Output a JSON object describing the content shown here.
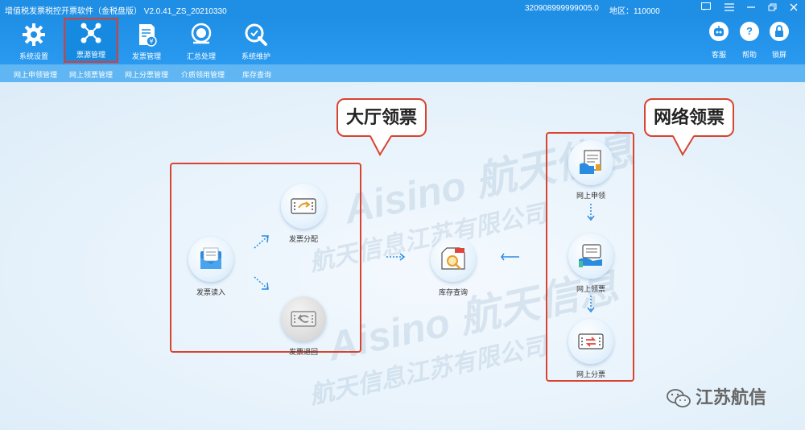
{
  "titlebar": {
    "app_title": "增值税发票税控开票软件（金税盘版） V2.0.41_ZS_20210330",
    "tax_number": "320908999999005.0",
    "region": "地区：110000"
  },
  "toolbar": {
    "items": [
      {
        "label": "系统设置",
        "icon": "gear-icon"
      },
      {
        "label": "票源管理",
        "icon": "network-icon",
        "active": true
      },
      {
        "label": "发票管理",
        "icon": "invoice-icon"
      },
      {
        "label": "汇总处理",
        "icon": "tax-summary-icon"
      },
      {
        "label": "系统维护",
        "icon": "wrench-icon"
      }
    ],
    "right": [
      {
        "label": "客服",
        "icon": "robot-icon"
      },
      {
        "label": "帮助",
        "icon": "help-icon",
        "glyph": "?"
      },
      {
        "label": "锁屏",
        "icon": "lock-icon"
      }
    ]
  },
  "menubar": {
    "items": [
      "网上申领管理",
      "网上领票管理",
      "网上分票管理",
      "介质领用管理",
      "库存查询"
    ]
  },
  "watermark": {
    "line1": "Aisino 航天信息",
    "line2": "航天信息江苏有限公司"
  },
  "callouts": {
    "hall": "大厅领票",
    "network": "网络领票"
  },
  "nodes": {
    "read_in": "发票读入",
    "allocate": "发票分配",
    "return": "发票退回",
    "inventory": "库存查询",
    "apply_online": "网上申领",
    "receive_online": "网上领票",
    "distribute_online": "网上分票"
  },
  "brand": {
    "text": "江苏航信"
  },
  "colors": {
    "primary": "#1f8fe6",
    "highlight_red": "#d9432f",
    "arrow_blue": "#2a8ce0"
  }
}
